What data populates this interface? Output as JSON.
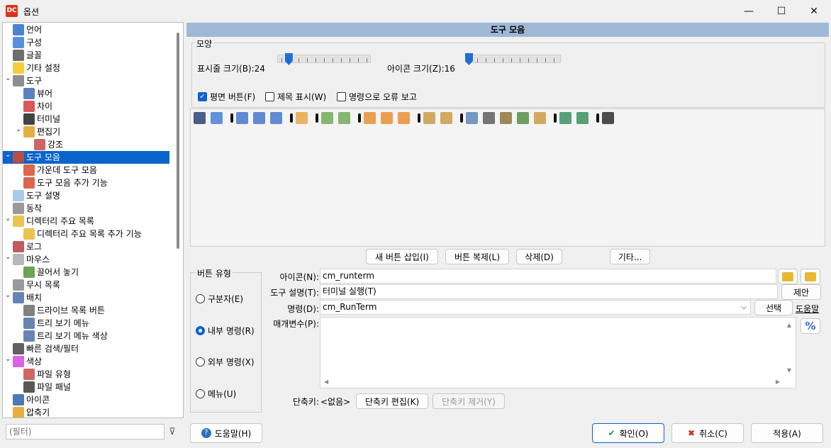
{
  "window": {
    "logo": "DC",
    "title": "옵션",
    "minimize": "—",
    "maximize": "☐",
    "close": "✕"
  },
  "tree": {
    "items": [
      {
        "label": "언어",
        "icon": "language-icon",
        "color": "#2a6fc9"
      },
      {
        "label": "구성",
        "icon": "layout-icon",
        "color": "#3d7bd6"
      },
      {
        "label": "글꼴",
        "icon": "font-icon",
        "color": "#555555"
      },
      {
        "label": "기타 설정",
        "icon": "smiley-icon",
        "color": "#f2c31b"
      },
      {
        "label": "도구",
        "icon": "tools-icon",
        "color": "#7a7a7a"
      },
      {
        "label": "뷰어",
        "icon": "book-icon",
        "color": "#3b6db3"
      },
      {
        "label": "차이",
        "icon": "diff-icon",
        "color": "#d33b3b"
      },
      {
        "label": "터미널",
        "icon": "terminal-icon",
        "color": "#222222"
      },
      {
        "label": "편집기",
        "icon": "edit-icon",
        "color": "#e0a020"
      },
      {
        "label": "강조",
        "icon": "highlight-icon",
        "color": "#c74b4b"
      },
      {
        "label": "도구 모음",
        "icon": "toolbar-icon",
        "color": "#d64a2c"
      },
      {
        "label": "가운데 도구 모음",
        "icon": "toolbar-middle-icon",
        "color": "#d64a2c"
      },
      {
        "label": "도구 모음 추가 기능",
        "icon": "toolbar-extra-icon",
        "color": "#d64a2c"
      },
      {
        "label": "도구 설명",
        "icon": "bulb-icon",
        "color": "#9ac2e8"
      },
      {
        "label": "동작",
        "icon": "action-icon",
        "color": "#888888"
      },
      {
        "label": "디렉터리 주요 목록",
        "icon": "folder-star-icon",
        "color": "#e8b930"
      },
      {
        "label": "디렉터리 주요 목록 추가 기능",
        "icon": "folder-extra-icon",
        "color": "#e8b930"
      },
      {
        "label": "로그",
        "icon": "log-icon",
        "color": "#b24141"
      },
      {
        "label": "마우스",
        "icon": "mouse-icon",
        "color": "#aaaaaa"
      },
      {
        "label": "끌어서 놓기",
        "icon": "drag-drop-icon",
        "color": "#5a8f3a"
      },
      {
        "label": "무시 목록",
        "icon": "ignore-list-icon",
        "color": "#888888"
      },
      {
        "label": "배치",
        "icon": "layout-icon",
        "color": "#4c6fa8"
      },
      {
        "label": "드라이브 목록 버튼",
        "icon": "drive-icon",
        "color": "#6b6b6b"
      },
      {
        "label": "트리 보기 메뉴",
        "icon": "tree-menu-icon",
        "color": "#4c6fa8"
      },
      {
        "label": "트리 보기 메뉴 색상",
        "icon": "tree-menu-color-icon",
        "color": "#4c6fa8"
      },
      {
        "label": "빠른 검색/필터",
        "icon": "binoculars-icon",
        "color": "#444444"
      },
      {
        "label": "색상",
        "icon": "color-wheel-icon",
        "color": "#d14ae0"
      },
      {
        "label": "파일 유형",
        "icon": "file-type-icon",
        "color": "#c74b4b"
      },
      {
        "label": "파일 패널",
        "icon": "file-panel-icon",
        "color": "#3b3b3b"
      },
      {
        "label": "아이콘",
        "icon": "icons-icon",
        "color": "#2f5fa8"
      },
      {
        "label": "압축기",
        "icon": "archive-icon",
        "color": "#e0a020"
      }
    ]
  },
  "filter": {
    "placeholder": "(필터)",
    "icon": "filter-clear-icon"
  },
  "panel": {
    "header": "도구 모음",
    "appearance": {
      "legend": "모양",
      "bar_size_label": "표시줄 크기(B):",
      "bar_size_value": "24",
      "icon_size_label": "아이콘 크기(Z):",
      "icon_size_value": "16",
      "bar_size_fraction": 0.12,
      "icon_size_fraction": 0.0,
      "flat_buttons": "평면 버튼(F)",
      "show_captions": "제목 표시(W)",
      "report_errors": "명령으로 오류 보고"
    },
    "toolbar_buttons": {
      "insert": "새 버튼 삽입(I)",
      "clone": "버튼 복제(L)",
      "delete": "삭제(D)",
      "other": "기타..."
    },
    "button_type": {
      "legend": "버튼 유형",
      "separator": "구분자(E)",
      "internal": "내부 명령(R)",
      "external": "외부 명령(X)",
      "menu": "메뉴(U)"
    },
    "form": {
      "icon_label": "아이콘(N):",
      "icon_value": "cm_runterm",
      "hint_label": "도구 설명(T):",
      "hint_value": "터미널 실행(T)",
      "suggest": "제안",
      "command_label": "명령(D):",
      "command_value": "cm_RunTerm",
      "select": "선택",
      "help_link": "도움말",
      "params_label": "매개변수(P):",
      "params_value": "",
      "percent": "%",
      "shortcut_label": "단축키:",
      "shortcut_value": "<없음>",
      "edit_hotkey": "단축키 편집(K)",
      "remove_hotkey": "단축키 제거(Y)"
    }
  },
  "footer": {
    "help": "도움말(H)",
    "ok": "확인(O)",
    "cancel": "취소(C)",
    "apply": "적용(A)"
  }
}
